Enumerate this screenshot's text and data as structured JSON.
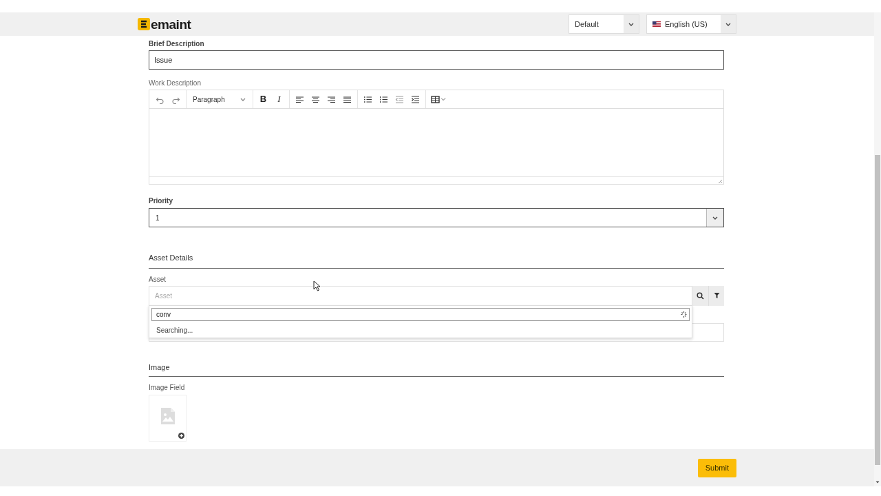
{
  "header": {
    "logo": "emaint",
    "selects": [
      {
        "value": "Default",
        "kind": "plain"
      },
      {
        "value": "English (US)",
        "kind": "flag"
      }
    ]
  },
  "brief_description": {
    "label": "Brief Description",
    "value": "Issue"
  },
  "work_description": {
    "label": "Work Description",
    "toolbar": [
      {
        "kind": "undo"
      },
      {
        "kind": "redo"
      },
      {
        "kind": "sep"
      },
      {
        "kind": "format",
        "label": "Paragraph"
      },
      {
        "kind": "sep"
      },
      {
        "kind": "bold",
        "label": "B"
      },
      {
        "kind": "italic",
        "label": "I"
      },
      {
        "kind": "sep"
      },
      {
        "kind": "align-left"
      },
      {
        "kind": "align-center"
      },
      {
        "kind": "align-right"
      },
      {
        "kind": "align-justify"
      },
      {
        "kind": "sep"
      },
      {
        "kind": "bullets"
      },
      {
        "kind": "numbers"
      },
      {
        "kind": "outdent"
      },
      {
        "kind": "indent"
      },
      {
        "kind": "sep"
      },
      {
        "kind": "table"
      }
    ]
  },
  "priority": {
    "label": "Priority",
    "value": "1"
  },
  "asset_details": {
    "heading": "Asset Details",
    "asset": {
      "label": "Asset",
      "placeholder": "Asset",
      "dropdown": {
        "search": "conv",
        "status": "Searching..."
      }
    }
  },
  "image": {
    "heading": "Image",
    "label": "Image Field"
  },
  "footer": {
    "button": "Submit"
  }
}
